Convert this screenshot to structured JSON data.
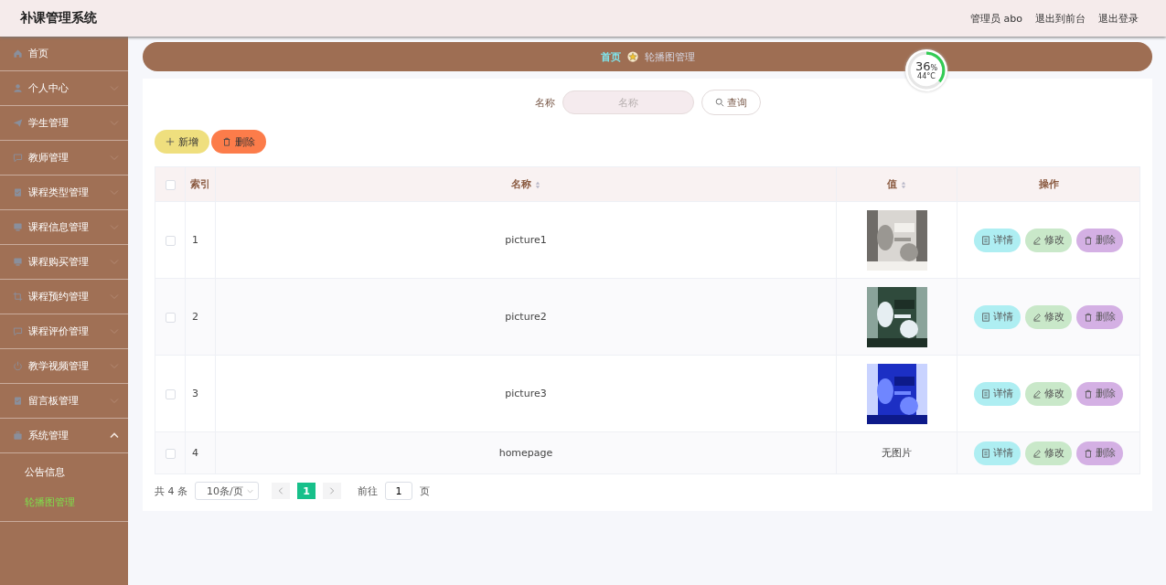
{
  "header": {
    "title": "补课管理系统",
    "user": "管理员 abo",
    "links": [
      "退出到前台",
      "退出登录"
    ]
  },
  "sidebar": {
    "items": [
      {
        "label": "首页",
        "kind": "link"
      },
      {
        "label": "个人中心",
        "kind": "menu",
        "expanded": false
      },
      {
        "label": "学生管理",
        "kind": "menu",
        "expanded": false
      },
      {
        "label": "教师管理",
        "kind": "menu",
        "expanded": false
      },
      {
        "label": "课程类型管理",
        "kind": "menu",
        "expanded": false
      },
      {
        "label": "课程信息管理",
        "kind": "menu",
        "expanded": false
      },
      {
        "label": "课程购买管理",
        "kind": "menu",
        "expanded": false
      },
      {
        "label": "课程预约管理",
        "kind": "menu",
        "expanded": false
      },
      {
        "label": "课程评价管理",
        "kind": "menu",
        "expanded": false
      },
      {
        "label": "教学视频管理",
        "kind": "menu",
        "expanded": false
      },
      {
        "label": "留言板管理",
        "kind": "menu",
        "expanded": false
      },
      {
        "label": "系统管理",
        "kind": "menu",
        "expanded": true,
        "children": [
          {
            "label": "公告信息",
            "selected": false
          },
          {
            "label": "轮播图管理",
            "selected": true
          }
        ]
      }
    ]
  },
  "breadcrumb": [
    "首页",
    "轮播图管理"
  ],
  "gauge": {
    "percent": "36",
    "unit": "%",
    "temperature": "44°C",
    "level": 0.36
  },
  "search": {
    "label": "名称",
    "placeholder": "名称",
    "button": "查询"
  },
  "actions": [
    "新增",
    "删除"
  ],
  "table": {
    "columns": [
      "索引",
      "名称",
      "值",
      "操作"
    ],
    "rows": [
      {
        "index": "1",
        "name": "picture1",
        "value": {
          "kind": "picture"
        },
        "checked": false,
        "actions": [
          "详情",
          "修改",
          "删除"
        ]
      },
      {
        "index": "2",
        "name": "picture2",
        "value": {
          "kind": "picture"
        },
        "checked": false,
        "actions": [
          "详情",
          "修改",
          "删除"
        ]
      },
      {
        "index": "3",
        "name": "picture3",
        "value": {
          "kind": "picture"
        },
        "checked": false,
        "actions": [
          "详情",
          "修改",
          "删除"
        ]
      },
      {
        "index": "4",
        "name": "homepage",
        "value": {
          "kind": "text",
          "text": "无图片"
        },
        "checked": false,
        "actions": [
          "详情",
          "修改",
          "删除"
        ]
      }
    ],
    "select_all_checked": false
  },
  "pagination": {
    "total": "共 4 条",
    "page_size": "10条/页",
    "pages": [
      {
        "label": "1",
        "selected": true
      }
    ],
    "goto_label": "前往",
    "goto_value": "1",
    "goto_suffix": "页"
  }
}
